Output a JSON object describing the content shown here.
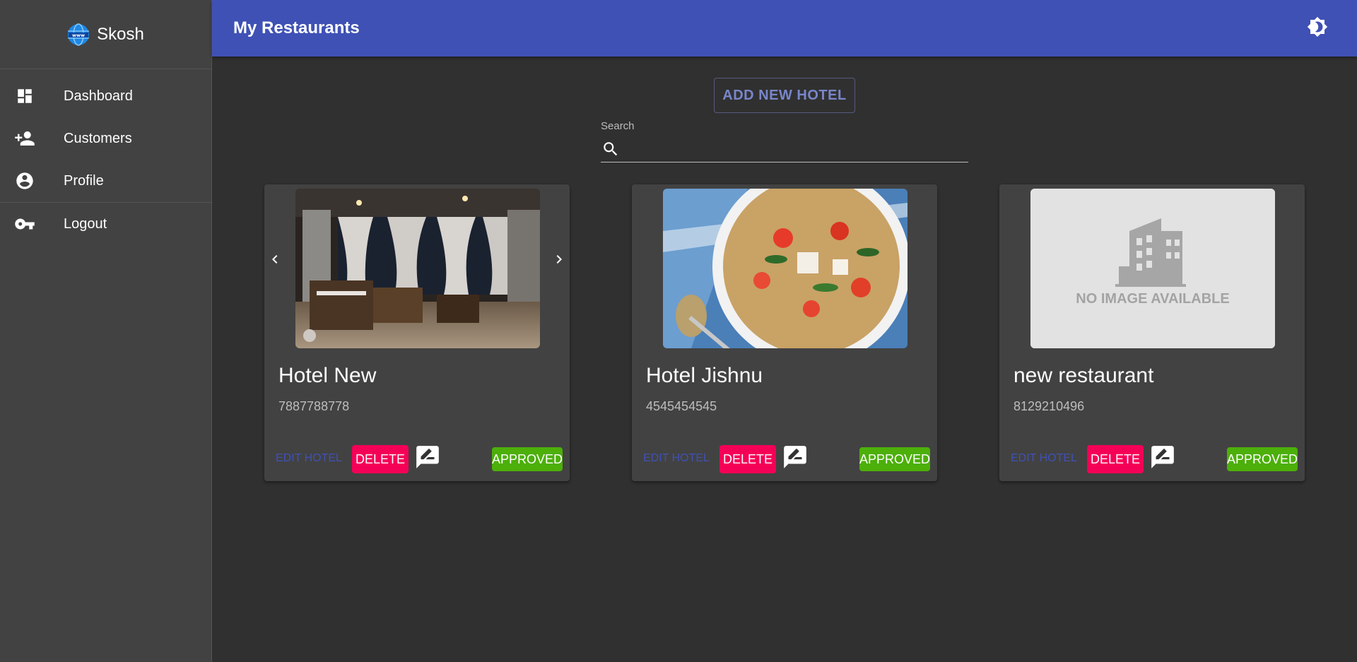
{
  "app": {
    "name": "Skosh",
    "logo_icon": "globe-www-icon"
  },
  "sidebar": {
    "items": [
      {
        "label": "Dashboard",
        "icon": "dashboard-icon"
      },
      {
        "label": "Customers",
        "icon": "person-add-icon"
      },
      {
        "label": "Profile",
        "icon": "account-circle-icon"
      },
      {
        "label": "Logout",
        "icon": "key-icon"
      }
    ]
  },
  "header": {
    "title": "My Restaurants",
    "theme_icon": "brightness-icon"
  },
  "main": {
    "add_button": "ADD NEW HOTEL",
    "search": {
      "label": "Search",
      "value": ""
    }
  },
  "hotels": [
    {
      "name": "Hotel New",
      "phone": "7887788778",
      "edit_label": "EDIT HOTEL",
      "delete_label": "DELETE",
      "status": "APPROVED",
      "image": "restaurant-interior-photo",
      "has_carousel": true
    },
    {
      "name": "Hotel Jishnu",
      "phone": "4545454545",
      "edit_label": "EDIT HOTEL",
      "delete_label": "DELETE",
      "status": "APPROVED",
      "image": "pasta-salad-photo",
      "has_carousel": false
    },
    {
      "name": "new restaurant",
      "phone": "8129210496",
      "edit_label": "EDIT HOTEL",
      "delete_label": "DELETE",
      "status": "APPROVED",
      "image": "no-image-placeholder",
      "placeholder_text": "NO IMAGE AVAILABLE",
      "has_carousel": false
    }
  ],
  "colors": {
    "appbar": "#3f51b5",
    "background": "#303030",
    "sidebar": "#424242",
    "card": "#424242",
    "delete": "#f50057",
    "approved": "#4caf0a",
    "edit": "#3f51b5"
  }
}
